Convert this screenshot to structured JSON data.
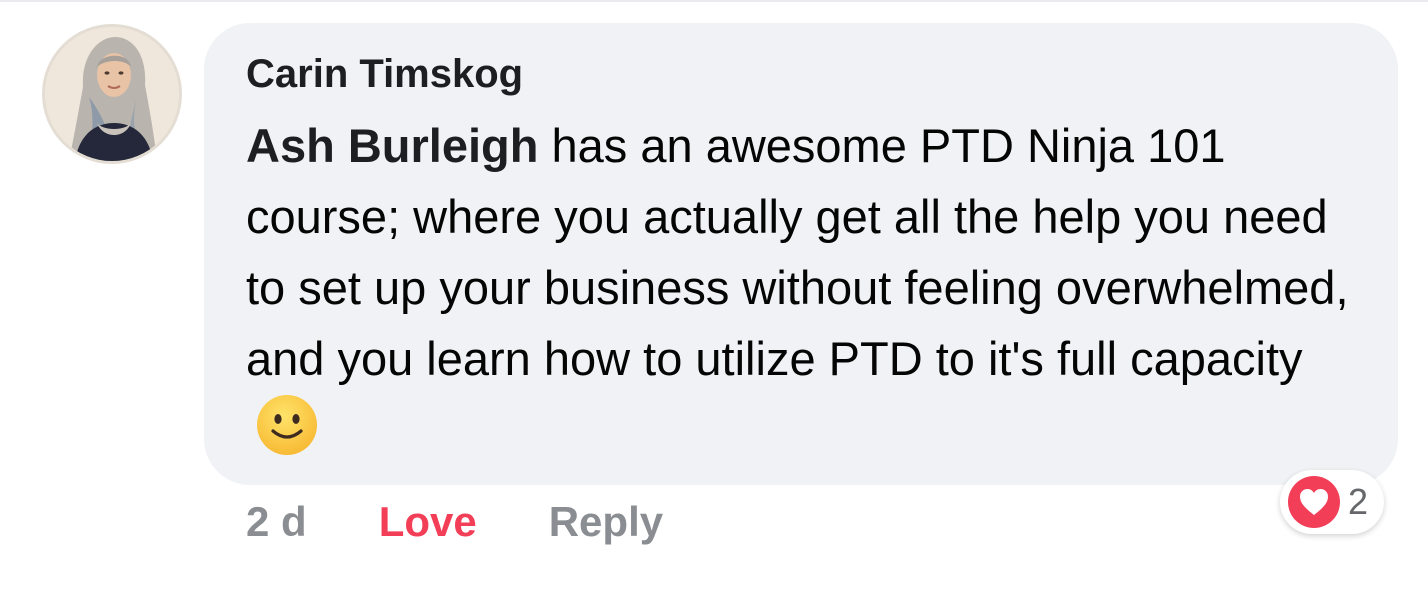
{
  "comment": {
    "author": "Carin Timskog",
    "mention": "Ash Burleigh",
    "text": " has an awesome PTD Ninja 101 course; where you actually get all the help you need to set up your business without feeling overwhelmed, and you learn how to utilize PTD to it's full capacity",
    "emoji": "slightly-smiling-face-icon"
  },
  "actions": {
    "timestamp": "2 d",
    "love_label": "Love",
    "reply_label": "Reply"
  },
  "reactions": {
    "type": "heart-icon",
    "count": "2"
  },
  "colors": {
    "bubble": "#f0f2f5",
    "love": "#f33e58",
    "muted": "#8a8d91",
    "text": "#050505"
  }
}
